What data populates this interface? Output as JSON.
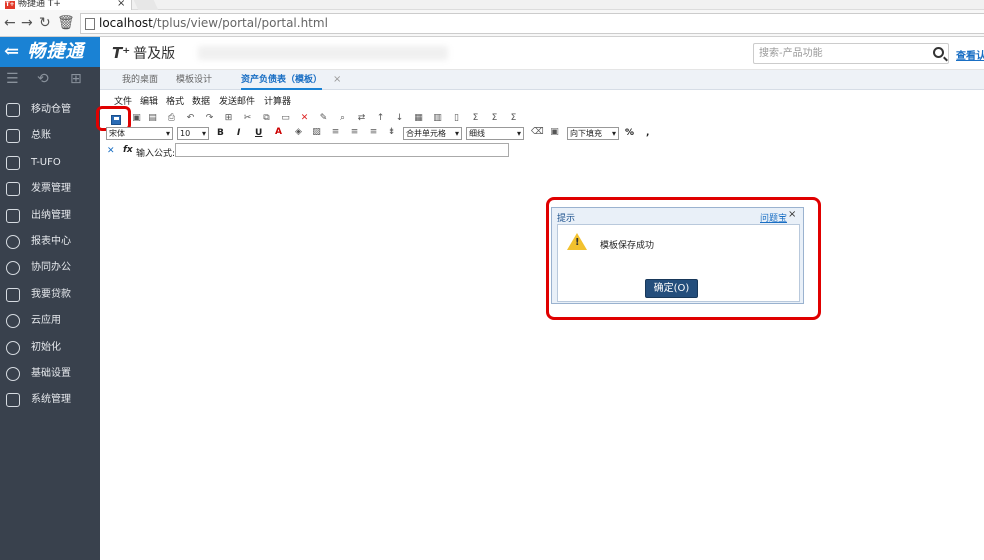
{
  "browser": {
    "tab_title": "畅捷通 T+",
    "favicon_text": "T+",
    "tab_close": "×",
    "url_host": "localhost",
    "url_path": "/tplus/view/portal/portal.html"
  },
  "app": {
    "logo_text": "⇐ 畅捷通",
    "brand": "T⁺",
    "brand_sub": "普及版",
    "search_placeholder": "搜索-产品功能",
    "right_link": "查看认"
  },
  "sidebar": {
    "items": [
      {
        "label": "移动仓管",
        "icon": "cube-icon"
      },
      {
        "label": "总账",
        "icon": "ledger-icon"
      },
      {
        "label": "T-UFO",
        "icon": "ufo-doc-icon"
      },
      {
        "label": "发票管理",
        "icon": "invoice-grid-icon"
      },
      {
        "label": "出纳管理",
        "icon": "cashier-icon"
      },
      {
        "label": "报表中心",
        "icon": "pie-chart-icon"
      },
      {
        "label": "协同办公",
        "icon": "collab-icon"
      },
      {
        "label": "我要贷款",
        "icon": "money-icon"
      },
      {
        "label": "云应用",
        "icon": "cloud-icon"
      },
      {
        "label": "初始化",
        "icon": "refresh-icon"
      },
      {
        "label": "基础设置",
        "icon": "settings-icon"
      },
      {
        "label": "系统管理",
        "icon": "monitor-icon"
      }
    ]
  },
  "tabs": [
    {
      "label": "我的桌面"
    },
    {
      "label": "模板设计"
    },
    {
      "label": "资产负债表（模板）"
    }
  ],
  "tab_close": "×",
  "menu": [
    "文件",
    "编辑",
    "格式",
    "数据",
    "发送邮件",
    "计算器"
  ],
  "format": {
    "font": "宋体",
    "size": "10",
    "bold": "B",
    "italic": "I",
    "underline": "U",
    "merge": "合并单元格",
    "border": "细线",
    "fill": "向下填充",
    "percent": "%",
    "comma": ","
  },
  "formula": {
    "fx": "fx",
    "label": "输入公式:"
  },
  "dialog": {
    "title": "提示",
    "help": "问题宝",
    "close": "×",
    "message": "模板保存成功",
    "ok": "确定(O)"
  }
}
